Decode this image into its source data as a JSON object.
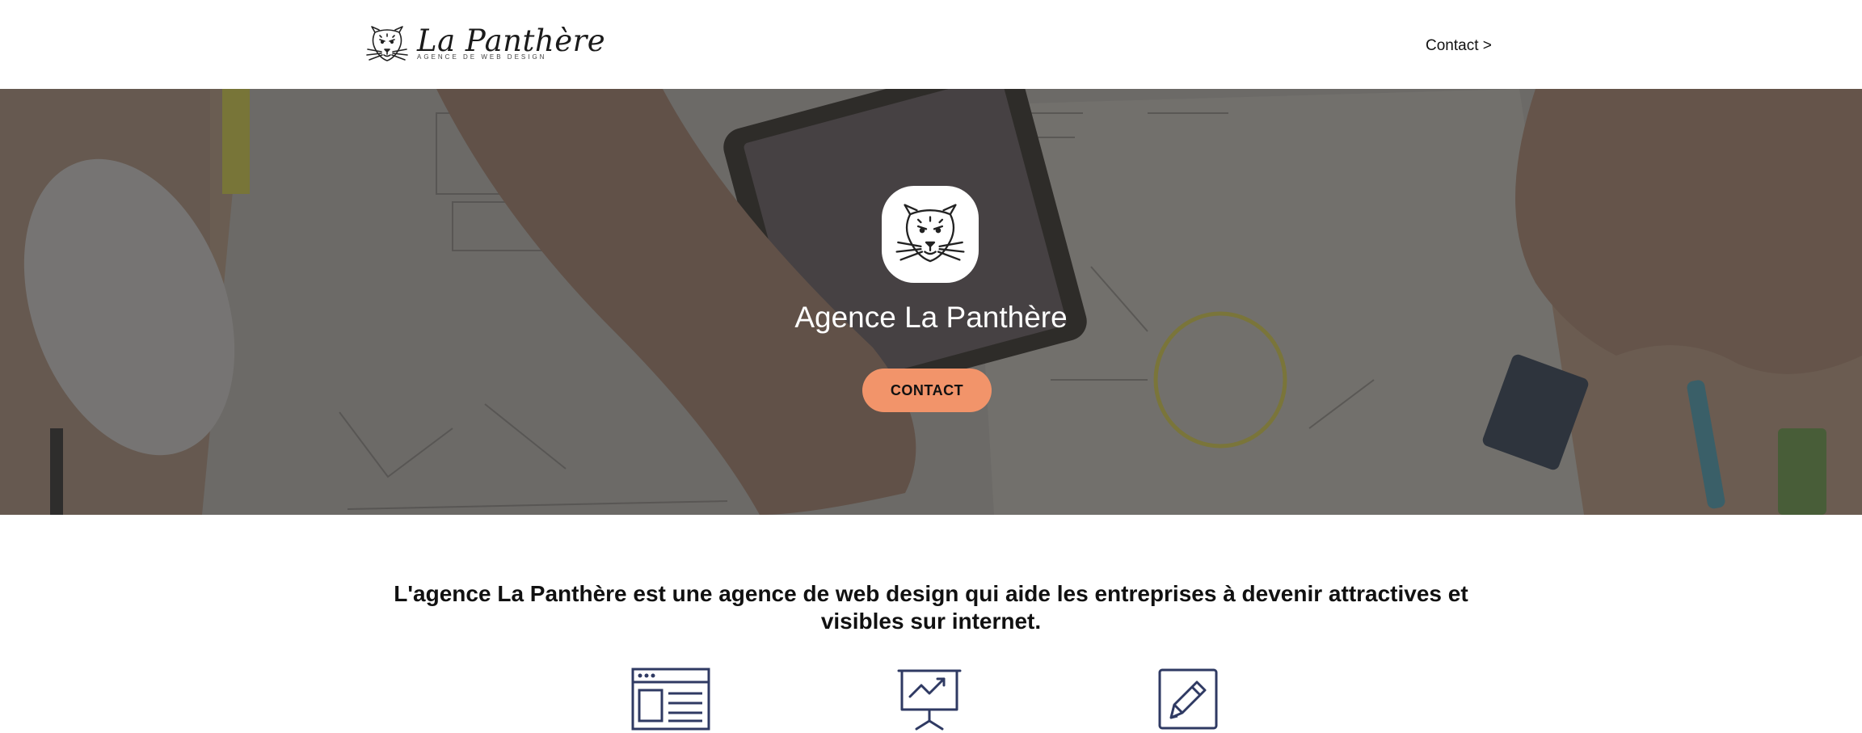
{
  "header": {
    "logo_name": "La Panthère",
    "logo_tagline": "Agence de web design",
    "nav_contact": "Contact >"
  },
  "hero": {
    "title": "Agence La Panthère",
    "button_label": "CONTACT"
  },
  "intro": {
    "text": "L'agence La Panthère est une agence de web design qui aide les entreprises à devenir attractives et visibles sur internet."
  },
  "features": [
    {
      "icon": "web-layout-icon"
    },
    {
      "icon": "presentation-chart-icon"
    },
    {
      "icon": "pencil-edit-icon"
    }
  ],
  "colors": {
    "accent": "#f2946a",
    "icon_navy": "#2f3a63",
    "hero_overlay": "#6b6866"
  }
}
